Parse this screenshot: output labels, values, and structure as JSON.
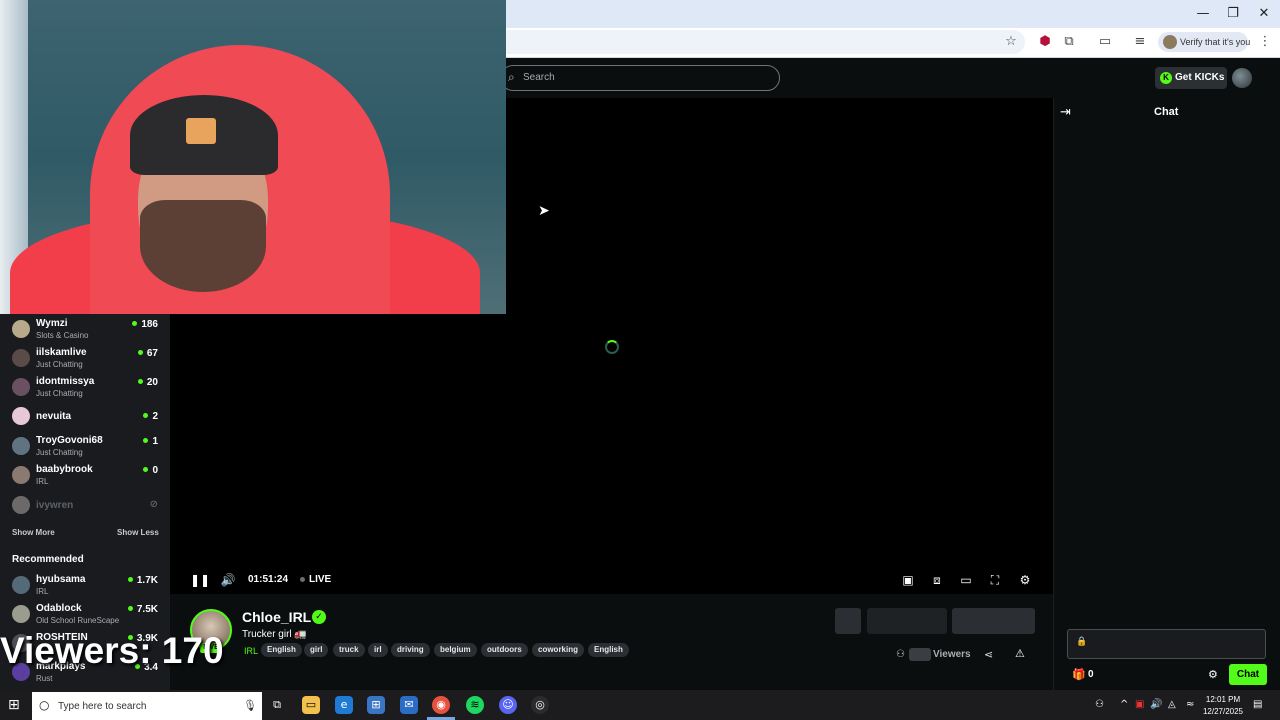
{
  "browser": {
    "verify_chip": "Verify that it's you",
    "window_controls": {
      "minimize": "—",
      "maximize": "❐",
      "close": "✕"
    }
  },
  "header": {
    "search_placeholder": "Search",
    "get_kicks_label": "Get KICKs",
    "kick_logo_glyph": "K"
  },
  "sidebar": {
    "following": [
      {
        "name": "Wymzi",
        "category": "Slots & Casino",
        "viewers": "186"
      },
      {
        "name": "iilskamlive",
        "category": "Just Chatting",
        "viewers": "67"
      },
      {
        "name": "idontmissya",
        "category": "Just Chatting",
        "viewers": "20"
      },
      {
        "name": "nevuita",
        "category": "",
        "viewers": "2"
      },
      {
        "name": "TroyGovoni68",
        "category": "Just Chatting",
        "viewers": "1"
      },
      {
        "name": "baabybrook",
        "category": "IRL",
        "viewers": "0"
      },
      {
        "name": "ivywren",
        "category": "",
        "viewers": ""
      }
    ],
    "show_more": "Show More",
    "show_less": "Show Less",
    "recommended_heading": "Recommended",
    "recommended": [
      {
        "name": "hyubsama",
        "category": "IRL",
        "viewers": "1.7K"
      },
      {
        "name": "Odablock",
        "category": "Old School RuneScape",
        "viewers": "7.5K"
      },
      {
        "name": "ROSHTEIN",
        "category": "",
        "viewers": "3.9K"
      },
      {
        "name": "markplays",
        "category": "Rust",
        "viewers": "3.4"
      }
    ]
  },
  "player": {
    "time": "01:51:24",
    "live_label": "LIVE"
  },
  "stream": {
    "streamer_name": "Chloe_IRL",
    "title": "Trucker girl",
    "title_emoji": "🚛",
    "category": "IRL",
    "live_badge": "LIVE",
    "tags": [
      "English",
      "girl",
      "truck",
      "irl",
      "driving",
      "belgium",
      "outdoors",
      "coworking",
      "English"
    ],
    "viewers_label": "Viewers",
    "viewers_overlay": "Viewers: 170"
  },
  "chat": {
    "title": "Chat",
    "points": "0",
    "send_label": "Chat"
  },
  "taskbar": {
    "search_placeholder": "Type here to search",
    "time": "12:01 PM",
    "date": "12/27/2025"
  }
}
